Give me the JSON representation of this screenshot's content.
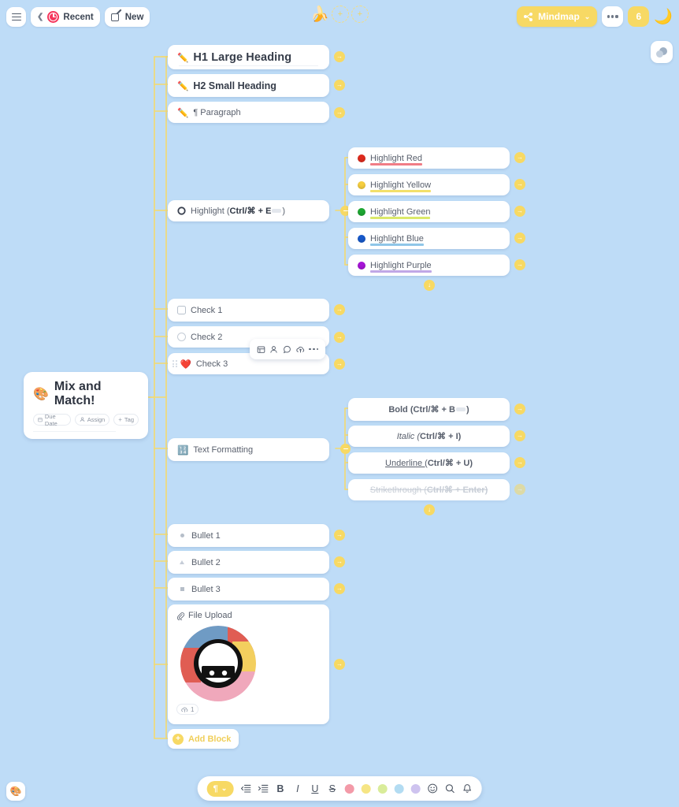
{
  "topbar": {
    "menu_icon": "hamburger-icon",
    "recent_label": "Recent",
    "new_label": "New",
    "mindmap_label": "Mindmap",
    "more_label": "•••",
    "count_badge": "6",
    "logo_emoji": "🍌",
    "right_emoji": "🌙"
  },
  "history_button": {
    "icon": "history-icon"
  },
  "palette_button": {
    "icon": "palette-icon",
    "glyph": "🎨"
  },
  "root": {
    "emoji": "🎨",
    "title": "Mix and Match!",
    "chips": [
      {
        "label": "Due Date",
        "icon": "calendar-icon"
      },
      {
        "label": "Assign",
        "icon": "person-icon"
      },
      {
        "label": "Tag",
        "icon": "plus-icon"
      }
    ]
  },
  "nodes": {
    "h1": {
      "emoji": "✏️",
      "text": "H1 Large Heading"
    },
    "h2": {
      "emoji": "✏️",
      "text": "H2 Small Heading"
    },
    "paragraph": {
      "emoji": "✏️",
      "pilcrow": "¶",
      "text": "Paragraph"
    },
    "highlight": {
      "icon": "circle-ring-icon",
      "prefix": "Highlight (",
      "kbd": "Ctrl/⌘ + E",
      "suffix": ")"
    },
    "check1": {
      "icon": "checkbox-square-icon",
      "text": "Check 1"
    },
    "check2": {
      "icon": "checkbox-circle-icon",
      "text": "Check 2"
    },
    "check3": {
      "icon": "heart-icon",
      "emoji": "❤️",
      "text": "Check 3"
    },
    "text_formatting": {
      "emoji": "🔢",
      "text": "Text Formatting"
    },
    "bullet1": {
      "marker": "circle",
      "text": "Bullet 1"
    },
    "bullet2": {
      "marker": "triangle",
      "text": "Bullet 2"
    },
    "bullet3": {
      "marker": "square",
      "text": "Bullet 3"
    },
    "file_upload": {
      "icon": "paperclip-icon",
      "text": "File Upload",
      "upload_count": "1"
    },
    "add_block": {
      "label": "Add Block",
      "icon": "plus-icon"
    }
  },
  "highlights": [
    {
      "label": "Highlight Red",
      "dot": "#e02b1d",
      "underline": "#f07d86"
    },
    {
      "label": "Highlight Yellow",
      "dot": "#f7cf3f",
      "underline": "#f3e06a"
    },
    {
      "label": "Highlight Green",
      "dot": "#1ea832",
      "underline": "#dbe96a"
    },
    {
      "label": "Highlight Blue",
      "dot": "#1759cb",
      "underline": "#8fc6e8"
    },
    {
      "label": "Highlight Purple",
      "dot": "#a715d8",
      "underline": "#c0a7e6"
    }
  ],
  "formatting": [
    {
      "style": "bold",
      "prefix": "Bold (",
      "kbd": "Ctrl/⌘ + B",
      "suffix": ")",
      "has_key_glyph": true
    },
    {
      "style": "italic",
      "prefix": "Italic (",
      "kbd": "Ctrl/⌘ + I",
      "suffix": ")",
      "has_key_glyph": false
    },
    {
      "style": "underline",
      "prefix": "Underline (",
      "kbd": "Ctrl/⌘ + U",
      "suffix": ")",
      "has_key_glyph": false
    },
    {
      "style": "strikethrough",
      "prefix": "Strikethrough (",
      "kbd": "Ctrl/⌘ + Enter",
      "suffix": ")",
      "has_key_glyph": false
    }
  ],
  "float_toolbar": {
    "items": [
      "card-icon",
      "person-icon",
      "comment-icon",
      "upload-icon",
      "more-icon"
    ]
  },
  "bottom_toolbar": {
    "paragraph_label": "¶",
    "chevron": "⌄",
    "buttons": [
      "outdent-icon",
      "indent-icon"
    ],
    "format_labels": [
      "B",
      "I",
      "U",
      "S"
    ],
    "swatches": [
      "#f39aa8",
      "#f6e584",
      "#d9ec9a",
      "#b3dcf2",
      "#cec3ef"
    ],
    "trailing": [
      "emoji-icon",
      "search-icon",
      "bell-icon"
    ]
  },
  "expand_arrow": "→",
  "expand_down": "↓"
}
